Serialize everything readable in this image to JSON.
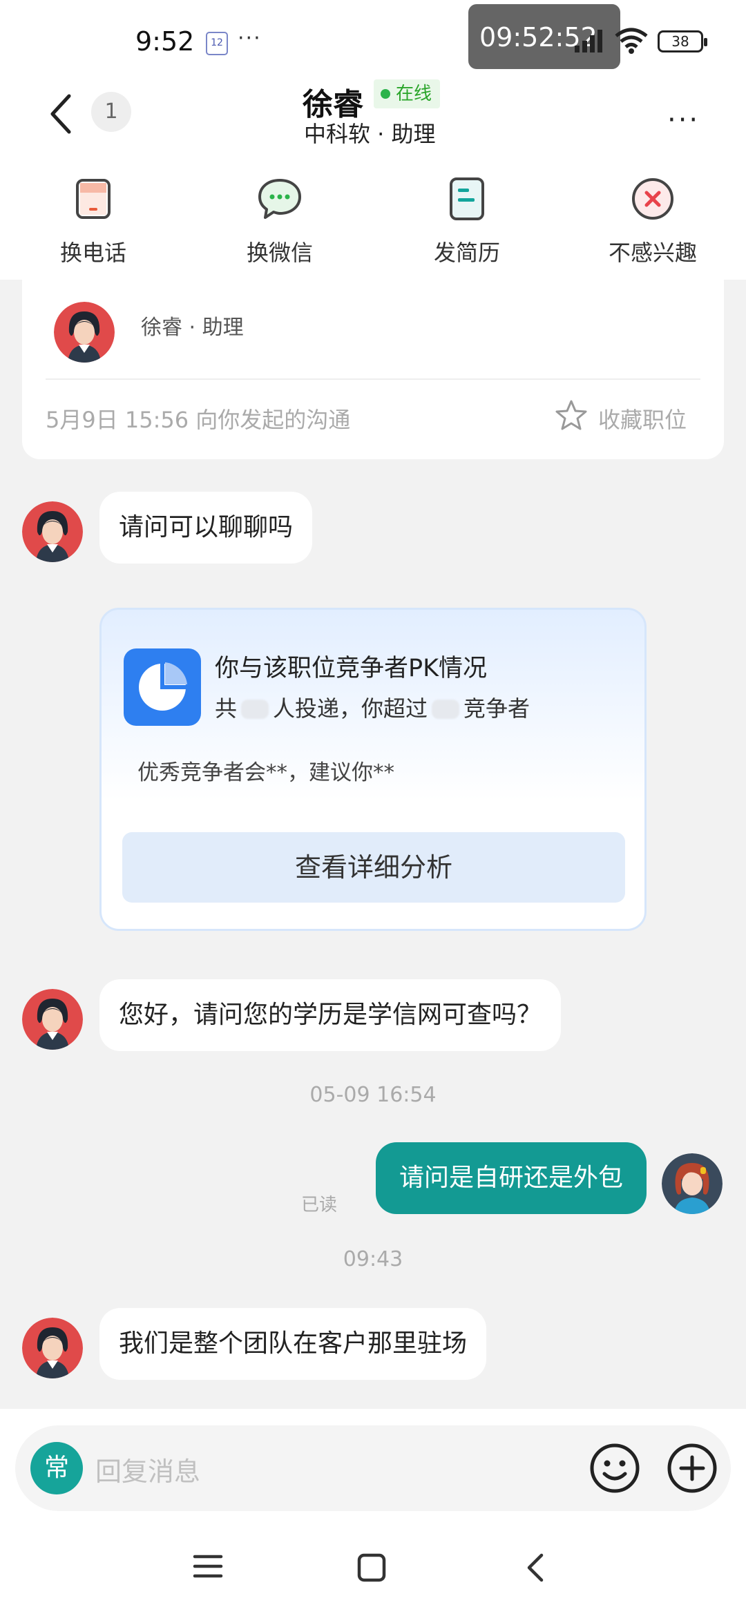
{
  "status_bar": {
    "time": "9:52",
    "calendar_badge": "12",
    "more_dots": "···",
    "clock_overlay": "09:52:52",
    "battery": "38"
  },
  "header": {
    "unread_count": "1",
    "contact_name": "徐睿",
    "online_status": "在线",
    "subtitle": "中科软 · 助理",
    "more": "···"
  },
  "actions": [
    {
      "label": "换电话",
      "icon": "phone-swap-icon"
    },
    {
      "label": "换微信",
      "icon": "wechat-swap-icon"
    },
    {
      "label": "发简历",
      "icon": "resume-icon"
    },
    {
      "label": "不感兴趣",
      "icon": "not-interested-icon"
    }
  ],
  "info_card": {
    "role": "徐睿 · 助理",
    "meta": "5月9日 15:56 向你发起的沟通",
    "favorite_label": "收藏职位"
  },
  "messages": {
    "m1": "请问可以聊聊吗",
    "m2": "您好，请问您的学历是学信网可查吗？",
    "time1": "05-09 16:54",
    "m3": "请问是自研还是外包",
    "read_tag": "已读",
    "time2": "09:43",
    "m4": "我们是整个团队在客户那里驻场"
  },
  "pk_card": {
    "title": "你与该职位竞争者PK情况",
    "sub_prefix": "共",
    "sub_mid": "人投递，你超过",
    "sub_suffix": "竞争者",
    "tip": "优秀竞争者会**，建议你**",
    "button": "查看详细分析"
  },
  "input": {
    "common_label": "常",
    "placeholder": "回复消息"
  },
  "colors": {
    "accent_teal": "#139a93",
    "online_green": "#2bb34a",
    "pk_blue": "#2e7ff0",
    "danger_red": "#e8434b"
  }
}
